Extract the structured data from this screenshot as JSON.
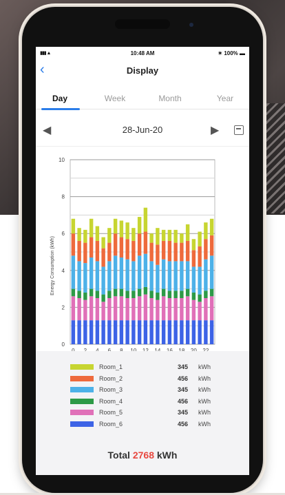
{
  "status": {
    "signal": "▮▮▮ ▲",
    "time": "10:48 AM",
    "battery": "✶ 100% ▬"
  },
  "nav": {
    "title": "Display",
    "back_icon": "chevron-left-icon"
  },
  "tabs": [
    "Day",
    "Week",
    "Month",
    "Year"
  ],
  "active_tab": "Day",
  "date": "28-Jun-20",
  "colors": {
    "accent": "#2b7de9",
    "total_highlight": "#e8473f"
  },
  "chart_data": {
    "type": "bar",
    "stacked": true,
    "ylabel": "Energy Consumption (kWh)",
    "ylim": [
      0,
      10
    ],
    "yticks": [
      "0",
      "2",
      "4",
      "6",
      "8",
      "10"
    ],
    "xticks": [
      "0",
      "2",
      "4",
      "6",
      "8",
      "10",
      "12",
      "14",
      "16",
      "18",
      "20",
      "22"
    ],
    "categories": [
      "0",
      "1",
      "2",
      "3",
      "4",
      "5",
      "6",
      "7",
      "8",
      "9",
      "10",
      "11",
      "12",
      "13",
      "14",
      "15",
      "16",
      "17",
      "18",
      "19",
      "20",
      "21",
      "22",
      "23"
    ],
    "series": [
      {
        "name": "Room_6",
        "color": "#3d63e6",
        "values": [
          1.3,
          1.3,
          1.3,
          1.3,
          1.3,
          1.3,
          1.3,
          1.3,
          1.3,
          1.3,
          1.3,
          1.3,
          1.3,
          1.3,
          1.3,
          1.3,
          1.3,
          1.3,
          1.3,
          1.3,
          1.3,
          1.3,
          1.3,
          1.3
        ]
      },
      {
        "name": "Room_5",
        "color": "#e070b8",
        "values": [
          1.3,
          1.2,
          1.1,
          1.3,
          1.2,
          1.0,
          1.2,
          1.3,
          1.3,
          1.2,
          1.2,
          1.3,
          1.4,
          1.2,
          1.1,
          1.3,
          1.2,
          1.2,
          1.2,
          1.3,
          1.1,
          1.0,
          1.2,
          1.3
        ]
      },
      {
        "name": "Room_4",
        "color": "#2d9a47",
        "values": [
          0.4,
          0.4,
          0.4,
          0.4,
          0.4,
          0.4,
          0.4,
          0.4,
          0.4,
          0.4,
          0.4,
          0.4,
          0.4,
          0.4,
          0.4,
          0.4,
          0.4,
          0.4,
          0.4,
          0.4,
          0.4,
          0.4,
          0.4,
          0.4
        ]
      },
      {
        "name": "Room_3",
        "color": "#4db1e8",
        "values": [
          1.8,
          1.6,
          1.6,
          1.7,
          1.6,
          1.5,
          1.6,
          1.8,
          1.7,
          1.7,
          1.6,
          1.8,
          1.8,
          1.6,
          1.5,
          1.6,
          1.6,
          1.6,
          1.6,
          1.5,
          1.4,
          1.5,
          1.7,
          1.8
        ]
      },
      {
        "name": "Room_2",
        "color": "#ee6a3c",
        "values": [
          1.2,
          1.1,
          1.1,
          1.1,
          1.1,
          1.0,
          1.0,
          1.2,
          1.1,
          1.1,
          1.1,
          1.2,
          1.2,
          1.0,
          1.1,
          1.0,
          1.1,
          1.0,
          1.0,
          1.1,
          0.9,
          1.1,
          1.1,
          1.1
        ]
      },
      {
        "name": "Room_1",
        "color": "#c7d531",
        "values": [
          0.8,
          0.7,
          0.7,
          1.0,
          0.8,
          0.6,
          0.8,
          0.8,
          0.9,
          0.9,
          0.7,
          0.9,
          1.3,
          0.5,
          0.9,
          0.6,
          0.6,
          0.7,
          0.5,
          0.9,
          0.6,
          0.8,
          0.9,
          0.9
        ]
      }
    ]
  },
  "legend": [
    {
      "name": "Room_1",
      "value": "345",
      "unit": "kWh",
      "color": "#c7d531"
    },
    {
      "name": "Room_2",
      "value": "456",
      "unit": "kWh",
      "color": "#ee6a3c"
    },
    {
      "name": "Room_3",
      "value": "345",
      "unit": "kWh",
      "color": "#4db1e8"
    },
    {
      "name": "Room_4",
      "value": "456",
      "unit": "kWh",
      "color": "#2d9a47"
    },
    {
      "name": "Room_5",
      "value": "345",
      "unit": "kWh",
      "color": "#e070b8"
    },
    {
      "name": "Room_6",
      "value": "456",
      "unit": "kWh",
      "color": "#3d63e6"
    }
  ],
  "total": {
    "label": "Total",
    "value": "2768",
    "unit": "kWh"
  }
}
